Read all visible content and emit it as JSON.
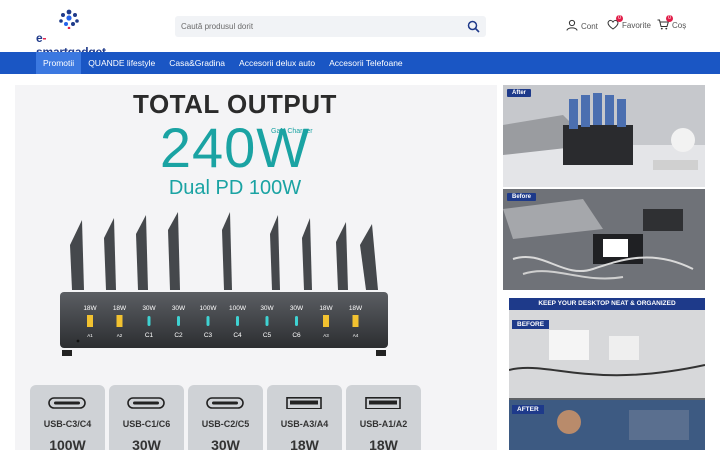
{
  "brand": {
    "name_prefix": "e",
    "name_dash": "-",
    "name_suffix": "smartgadget",
    "color": "#1f3a8a",
    "accent": "#e11d48"
  },
  "search": {
    "placeholder": "Caută produsul dorit",
    "icon": "search-icon"
  },
  "account": {
    "cont_label": "Cont",
    "favorite_label": "Favorite",
    "favorite_count": "0",
    "cos_label": "Coș",
    "cos_count": "0"
  },
  "nav": {
    "color": "#1a56c4",
    "items": [
      {
        "label": "Promotii",
        "active": true
      },
      {
        "label": "QUANDE lifestyle"
      },
      {
        "label": "Casa&Gradina"
      },
      {
        "label": "Accesorii delux auto"
      },
      {
        "label": "Accesorii Telefoane"
      }
    ]
  },
  "banner": {
    "title": "TOTAL OUTPUT",
    "gan": "GaN Charger",
    "watt": "240W",
    "dual": "Dual PD 100W",
    "charger_ports": [
      {
        "w": "18W",
        "n": "A1"
      },
      {
        "w": "18W",
        "n": "A2"
      },
      {
        "w": "30W",
        "n": "C1"
      },
      {
        "w": "30W",
        "n": "C2"
      },
      {
        "w": "100W",
        "n": "C3"
      },
      {
        "w": "100W",
        "n": "C4"
      },
      {
        "w": "30W",
        "n": "C5"
      },
      {
        "w": "30W",
        "n": "C6"
      },
      {
        "w": "18W",
        "n": "A3"
      },
      {
        "w": "18W",
        "n": "A4"
      }
    ],
    "ports": [
      {
        "label": "USB-C3/C4",
        "watt": "100W",
        "kind": "usbc"
      },
      {
        "label": "USB-C1/C6",
        "watt": "30W",
        "kind": "usbc"
      },
      {
        "label": "USB-C2/C5",
        "watt": "30W",
        "kind": "usbc"
      },
      {
        "label": "USB-A3/A4",
        "watt": "18W",
        "kind": "usba"
      },
      {
        "label": "USB-A1/A2",
        "watt": "18W",
        "kind": "usba"
      }
    ]
  },
  "side": {
    "after": "After",
    "before": "Before",
    "headline": "KEEP YOUR DESKTOP NEAT & ORGANIZED",
    "before2": "BEFORE",
    "after2": "AFTER"
  }
}
